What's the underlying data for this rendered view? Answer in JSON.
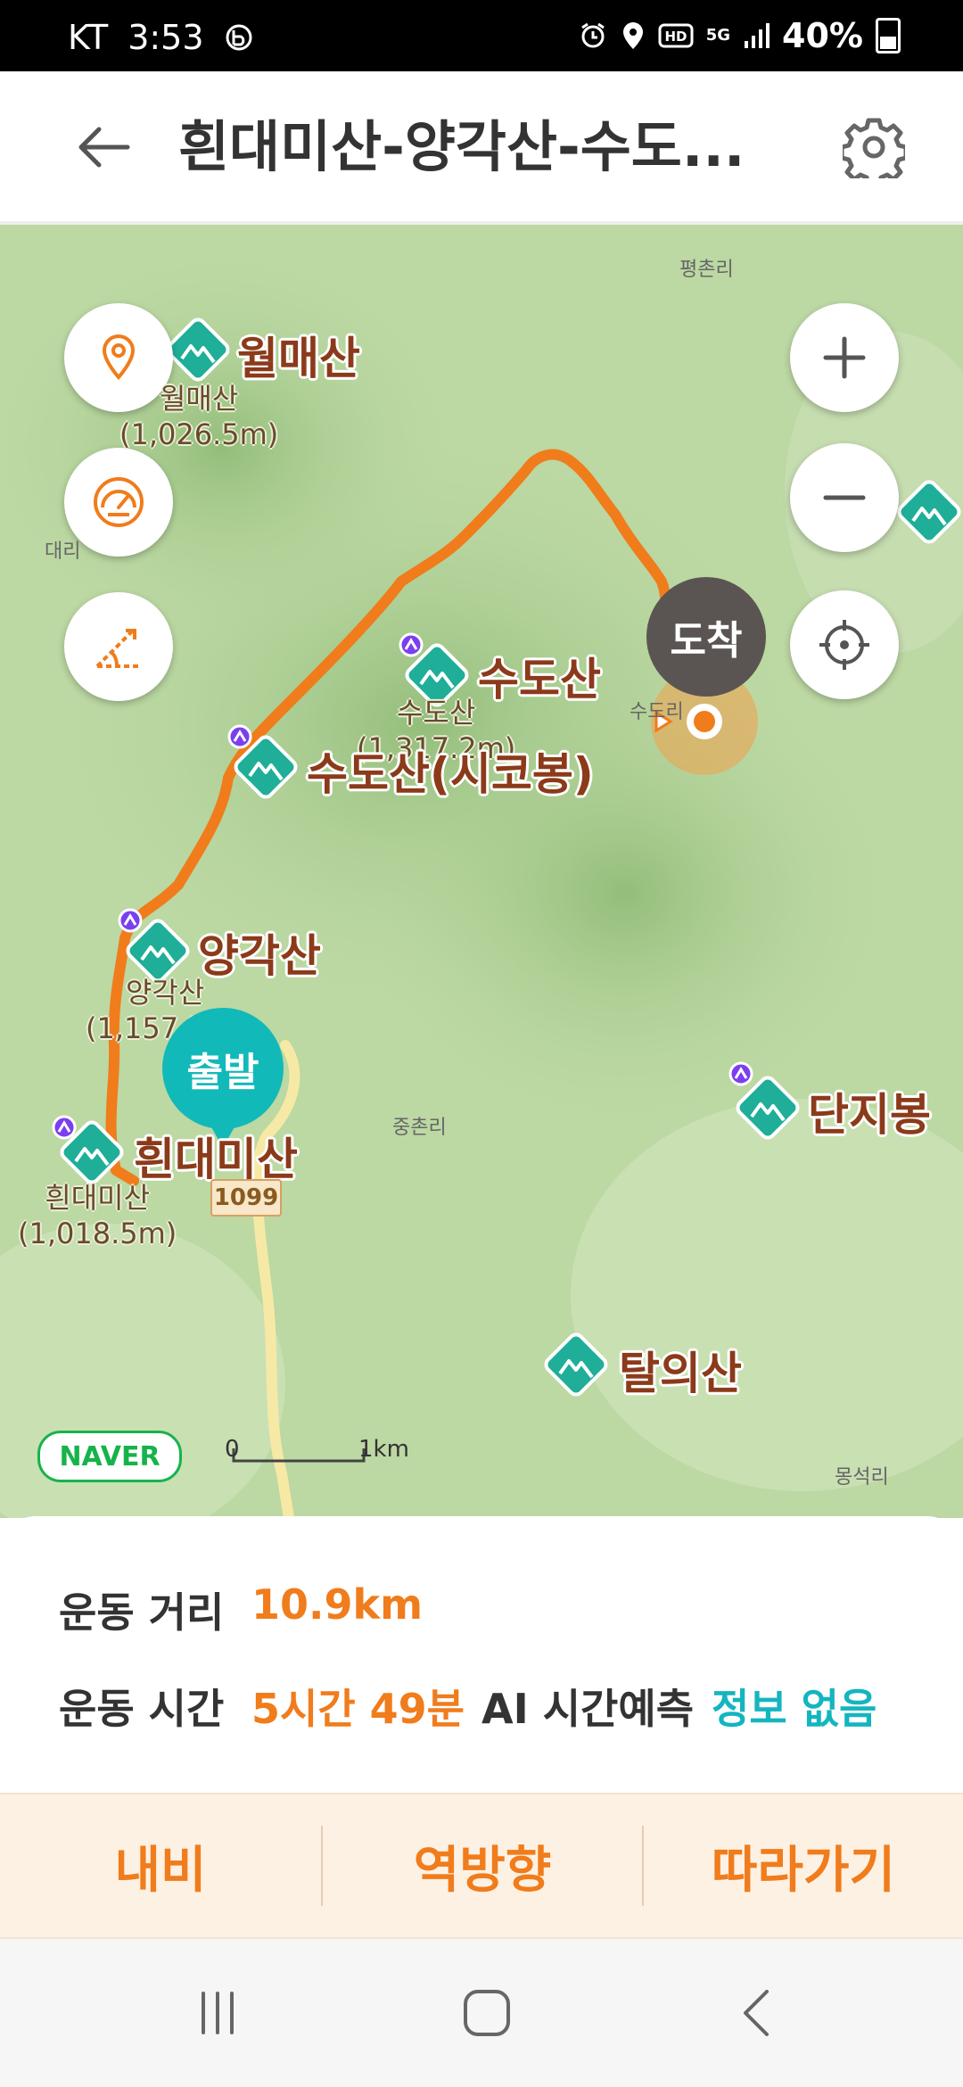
{
  "status_bar": {
    "carrier": "KT",
    "time": "3:53",
    "network": "5G",
    "battery": "40%"
  },
  "header": {
    "title": "흰대미산-양각산-수도..."
  },
  "map": {
    "peaks": [
      {
        "name": "월매산",
        "elevation_label": "월매산\n(1,026.5m)"
      },
      {
        "name": "수도산",
        "elevation_label": "수도산\n(1,317.2m)"
      },
      {
        "name": "수도산(시코봉)"
      },
      {
        "name": "양각산",
        "elevation_label": "양각산\n(1,157.5m)"
      },
      {
        "name": "흰대미산",
        "elevation_label": "흰대미산\n(1,018.5m)"
      },
      {
        "name": "단지봉"
      },
      {
        "name": "탈의산"
      }
    ],
    "start_label": "출발",
    "end_label": "도착",
    "villages": [
      "평촌리",
      "대리",
      "중촌리",
      "몽석리",
      "수도리"
    ],
    "road_number": "1099",
    "brand": "NAVER",
    "scale": {
      "start": "0",
      "end": "1km"
    },
    "route_color": "#f07c1c",
    "peak_icon_color": "#1fae98"
  },
  "stats": {
    "distance_label": "운동 거리",
    "distance_value": "10.9km",
    "time_label": "운동 시간",
    "time_value": "5시간 49분",
    "ai_label": "AI 시간예측",
    "ai_value": "정보 없음"
  },
  "actions": {
    "navi": "내비",
    "reverse": "역방향",
    "follow": "따라가기"
  }
}
